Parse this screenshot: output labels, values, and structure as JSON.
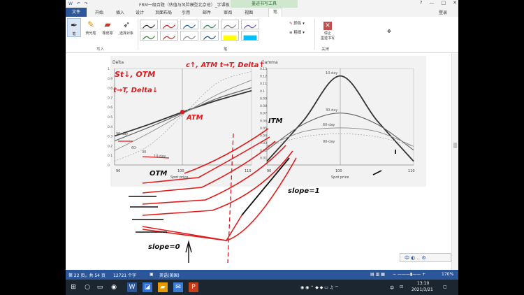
{
  "window": {
    "title": "FRM一级百题（估值与风险模型北京班）_字课板 [兼容...",
    "context_tab": "墨迹书写工具",
    "quick_access": "W ↶ ↷",
    "login": "登录",
    "controls": [
      "?",
      "—",
      "□",
      "✕"
    ]
  },
  "tabs": [
    {
      "label": "文件"
    },
    {
      "label": "开始"
    },
    {
      "label": "插入"
    },
    {
      "label": "设计"
    },
    {
      "label": "页面布局"
    },
    {
      "label": "引用"
    },
    {
      "label": "邮件"
    },
    {
      "label": "审阅"
    },
    {
      "label": "视图"
    },
    {
      "label": "笔"
    }
  ],
  "ribbon": {
    "write_group": "写入",
    "pen_group": "笔",
    "close_group": "关闭",
    "pen_button": "笔",
    "highlighter_button": "荧光笔",
    "eraser_button": "橡皮擦",
    "select_button": "选择对象",
    "color_label": "颜色",
    "thickness_label": "粗细",
    "stop_label": "停止\n墨迹书写",
    "pen_colors": [
      "#333333",
      "#d62728",
      "#2e6b9e",
      "#2e8b57",
      "#7f7f7f",
      "#6a5acd",
      "#3a7d44",
      "#c0392b",
      "#888888",
      "#1f4e79",
      "#ffff00",
      "#00c0ff"
    ]
  },
  "left_chart": {
    "ylabel": "Delta",
    "xlabel": "Spot price",
    "xticks": [
      "90",
      "100",
      "110"
    ],
    "yticks": [
      "1",
      "0.9",
      "0.8",
      "0.7",
      "0.6",
      "0.5",
      "0.4",
      "0.3",
      "0.2",
      "0.1",
      "0"
    ],
    "series_labels": [
      "90-day",
      "60-",
      "30",
      "10-day"
    ]
  },
  "right_chart": {
    "ylabel": "Gamma",
    "xlabel": "Spot price",
    "xticks": [
      "90",
      "100",
      "110"
    ],
    "yticks": [
      "0.13",
      "0.12",
      "0.11",
      "0.1",
      "0.09",
      "0.08",
      "0.07",
      "0.06",
      "0.05",
      "0.04",
      "0.03",
      "0.02",
      "0.01"
    ],
    "series_labels": [
      "10-day",
      "30-day",
      "60-day",
      "90-day"
    ]
  },
  "ink": {
    "st_otm": "St↓, OTM",
    "t_delta": "t→T, Delta↓",
    "ct_atm": "c↑, ATM  t→T, Delta↑",
    "atm": "ATM",
    "otm": "OTM",
    "itm": "ITM",
    "slope1": "slope=1",
    "slope0": "slope=0"
  },
  "status": {
    "page": "第 22 页，共 54 页",
    "words": "12721 个字",
    "lang": "英语(美国)",
    "zoom": "170%"
  },
  "ime": "中 ◐ ‥ ⚙",
  "tray": {
    "time": "13:10",
    "date": "2021/3/21",
    "ime_lang": "中"
  },
  "chart_data": [
    {
      "type": "line",
      "title": "",
      "xlabel": "Spot price",
      "ylabel": "Delta",
      "x": [
        90,
        95,
        100,
        105,
        110
      ],
      "xlim": [
        90,
        110
      ],
      "ylim": [
        0,
        1
      ],
      "series": [
        {
          "name": "90-day",
          "values": [
            0.3,
            0.42,
            0.55,
            0.67,
            0.77
          ]
        },
        {
          "name": "60-",
          "values": [
            0.25,
            0.39,
            0.54,
            0.69,
            0.8
          ]
        },
        {
          "name": "30",
          "values": [
            0.15,
            0.33,
            0.53,
            0.73,
            0.88
          ]
        },
        {
          "name": "10-day",
          "values": [
            0.04,
            0.2,
            0.52,
            0.85,
            0.97
          ]
        }
      ]
    },
    {
      "type": "line",
      "title": "",
      "xlabel": "Spot price",
      "ylabel": "Gamma",
      "x": [
        90,
        95,
        100,
        105,
        110
      ],
      "xlim": [
        90,
        110
      ],
      "ylim": [
        0,
        0.13
      ],
      "series": [
        {
          "name": "10-day",
          "values": [
            0.005,
            0.06,
            0.12,
            0.06,
            0.005
          ]
        },
        {
          "name": "30-day",
          "values": [
            0.02,
            0.055,
            0.07,
            0.055,
            0.02
          ]
        },
        {
          "name": "60-day",
          "values": [
            0.025,
            0.045,
            0.05,
            0.045,
            0.025
          ]
        },
        {
          "name": "90-day",
          "values": [
            0.025,
            0.038,
            0.042,
            0.038,
            0.025
          ]
        }
      ]
    }
  ]
}
